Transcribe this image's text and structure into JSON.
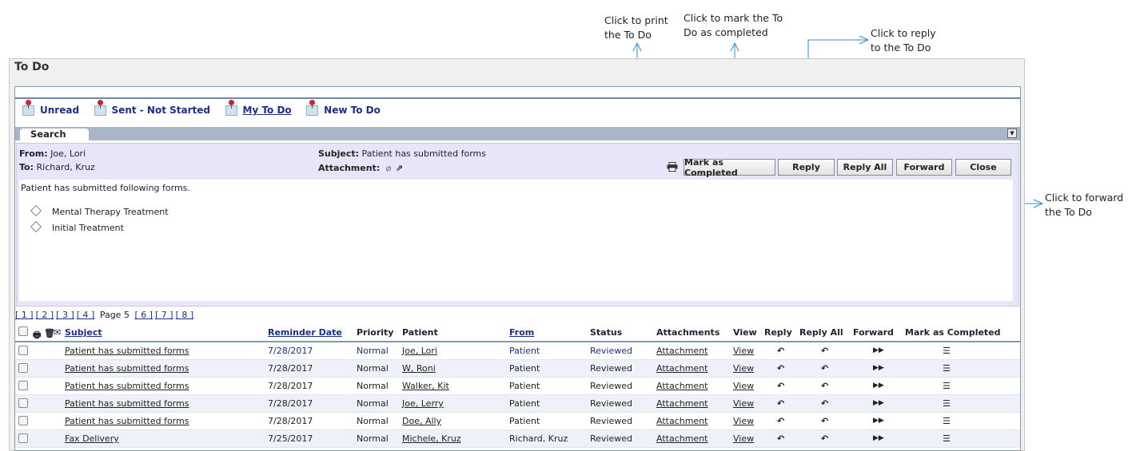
{
  "annotations": {
    "print": "Click to print the To Do",
    "complete": "Click to mark the To Do as completed",
    "reply": "Click to reply to the To Do",
    "forward": "Click to forward the To Do"
  },
  "panel": {
    "title": "To Do"
  },
  "nav": [
    {
      "label": "Unread"
    },
    {
      "label": "Sent - Not Started"
    },
    {
      "label": "My To Do"
    },
    {
      "label": "New To Do"
    }
  ],
  "search": {
    "tab_label": "Search"
  },
  "message": {
    "from_label": "From:",
    "from": "Joe, Lori",
    "to_label": "To:",
    "to": "Richard, Kruz",
    "subject_label": "Subject:",
    "subject": "Patient has submitted forms",
    "attachment_label": "Attachment:",
    "body": "Patient has submitted following forms.",
    "forms": [
      "Mental Therapy Treatment",
      "Initial Treatment"
    ]
  },
  "buttons": {
    "mark_completed": "Mark as Completed",
    "reply": "Reply",
    "reply_all": "Reply All",
    "forward": "Forward",
    "close": "Close"
  },
  "pager": {
    "pages": [
      "[ 1 ]",
      "[ 2 ]",
      "[ 3 ]",
      "[ 4 ]"
    ],
    "current": "Page 5",
    "next_pages": [
      "[ 6 ]",
      "[ 7 ]",
      "[ 8 ]"
    ]
  },
  "grid": {
    "columns": {
      "subject": "Subject",
      "reminder_date": "Reminder Date",
      "priority": "Priority",
      "patient": "Patient",
      "from": "From",
      "status": "Status",
      "attachments": "Attachments",
      "view": "View",
      "reply": "Reply",
      "reply_all": "Reply All",
      "forward": "Forward",
      "mark_completed": "Mark as Completed"
    },
    "rows": [
      {
        "subject": "Patient has submitted forms",
        "date": "7/28/2017",
        "priority": "Normal",
        "patient": "Joe, Lori",
        "from": "Patient",
        "status": "Reviewed",
        "attachments": "Attachment",
        "view": "View"
      },
      {
        "subject": "Patient has submitted forms",
        "date": "7/28/2017",
        "priority": "Normal",
        "patient": "W, Roni",
        "from": "Patient",
        "status": "Reviewed",
        "attachments": "Attachment",
        "view": "View"
      },
      {
        "subject": "Patient has submitted forms",
        "date": "7/28/2017",
        "priority": "Normal",
        "patient": "Walker, Kit",
        "from": "Patient",
        "status": "Reviewed",
        "attachments": "Attachment",
        "view": "View"
      },
      {
        "subject": "Patient has submitted forms",
        "date": "7/28/2017",
        "priority": "Normal",
        "patient": "Joe, Lerry",
        "from": "Patient",
        "status": "Reviewed",
        "attachments": "Attachment",
        "view": "View"
      },
      {
        "subject": "Patient has submitted forms",
        "date": "7/28/2017",
        "priority": "Normal",
        "patient": "Doe, Ally",
        "from": "Patient",
        "status": "Reviewed",
        "attachments": "Attachment",
        "view": "View"
      },
      {
        "subject": "Fax Delivery",
        "date": "7/25/2017",
        "priority": "Normal",
        "patient": "Michele, Kruz",
        "from": "Richard, Kruz",
        "status": "Reviewed",
        "attachments": "Attachment",
        "view": "View"
      }
    ]
  },
  "colors": {
    "link": "#1c2d8c",
    "callout": "#2b8fd6",
    "message_bg": "#e6e6f8",
    "search_bar": "#aab6c8"
  }
}
